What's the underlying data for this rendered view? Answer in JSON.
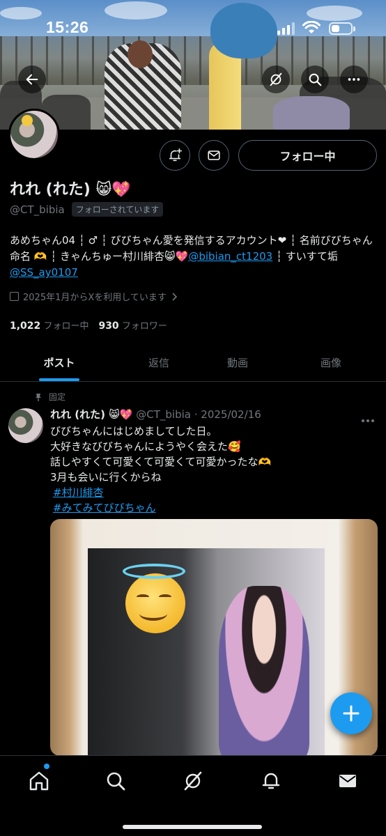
{
  "status_bar": {
    "time": "15:26",
    "battery_level": 0.35
  },
  "profile": {
    "display_name": "れれ (れた) 😸💖",
    "handle": "@CT_bibia",
    "follows_you_badge": "フォローされています",
    "follow_button_label": "フォロー中",
    "bio": {
      "text_1": "あめちゃん04 ┆ ♂ ┆ びびちゃん愛を発信するアカウント❤︎ ┆ 名前びびちゃん命名 🫶 ┆ きゃんちゅー村川緋杏😸💖",
      "mention_1": "@bibian_ct1203",
      "text_2": " ┆ すいすて垢",
      "mention_2": "@SS_ay0107"
    },
    "joined": "2025年1月からXを利用しています",
    "following_count": "1,022",
    "following_label": "フォロー中",
    "followers_count": "930",
    "followers_label": "フォロワー"
  },
  "tabs": [
    {
      "label": "ポスト",
      "active": true
    },
    {
      "label": "返信",
      "active": false
    },
    {
      "label": "動画",
      "active": false
    },
    {
      "label": "画像",
      "active": false
    }
  ],
  "post": {
    "pinned_label": "固定",
    "author_name": "れれ (れた) 😸💖",
    "author_handle_date": "@CT_bibia · 2025/02/16",
    "lines": [
      "びびちゃんにはじめましてした日。",
      "大好きなびびちゃんにようやく会えた🥰",
      "話しやすくて可愛くて可愛くて可愛かったな🫶",
      "3月も会いに行くからね"
    ],
    "hashtags": [
      "#村川緋杏",
      "#みてみてびびちゃん"
    ]
  },
  "icons": {
    "back": "arrow-left-icon",
    "grok": "grok-icon",
    "search": "search-icon",
    "more": "more-icon",
    "notify": "bell-plus-icon",
    "message": "mail-icon",
    "compose": "plus-icon"
  },
  "colors": {
    "accent": "#1d9bf0",
    "background": "#000000",
    "text_primary": "#e7e9ea",
    "text_secondary": "#71767b"
  }
}
